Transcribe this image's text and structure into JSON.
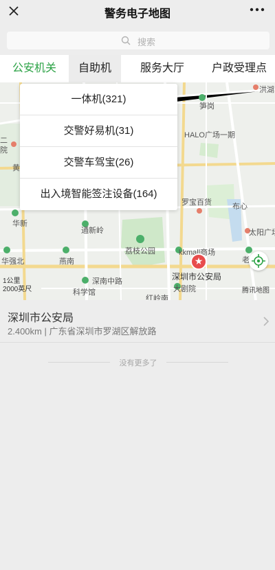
{
  "header": {
    "title": "警务电子地图"
  },
  "search": {
    "placeholder": "搜索"
  },
  "tabs": [
    {
      "label": "公安机关",
      "active": true
    },
    {
      "label": "自助机",
      "active": false
    },
    {
      "label": "服务大厅",
      "active": false
    },
    {
      "label": "户政受理点",
      "active": false
    }
  ],
  "dropdown": {
    "items": [
      {
        "label": "一体机(321)"
      },
      {
        "label": "交警好易机(31)"
      },
      {
        "label": "交警车驾宝(26)"
      },
      {
        "label": "出入境智能签注设备(164)"
      }
    ]
  },
  "map": {
    "labels": {
      "honghu": "洪湖",
      "sungang": "笋岗",
      "halo": "HALO广场一期",
      "luobao": "罗宝百货",
      "buxin": "布心",
      "taiyang": "太阳广场",
      "huaxin": "华新",
      "tongxinling": "通新岭",
      "lizhi": "荔枝公园",
      "kkmall": "kkmall商场",
      "huaqiangbei": "华强北",
      "yanan": "燕南",
      "shennan": "深南中路",
      "kexueguan": "科学馆",
      "hongling": "红岭南",
      "police": "深圳市公安局",
      "dajuyuan": "大剧院",
      "er": "二",
      "yuan": "院",
      "huang": "黄",
      "lao": "老"
    },
    "scale_top": "1公里",
    "scale_bottom": "2000英尺",
    "provider": "腾讯地图",
    "pin_glyph": "★",
    "colors": {
      "pin": "#e84c4c",
      "accent": "#2ba245"
    }
  },
  "result": {
    "name": "深圳市公安局",
    "info": "2.400km | 广东省深圳市罗湖区解放路"
  },
  "footer": {
    "end_text": "没有更多了"
  }
}
